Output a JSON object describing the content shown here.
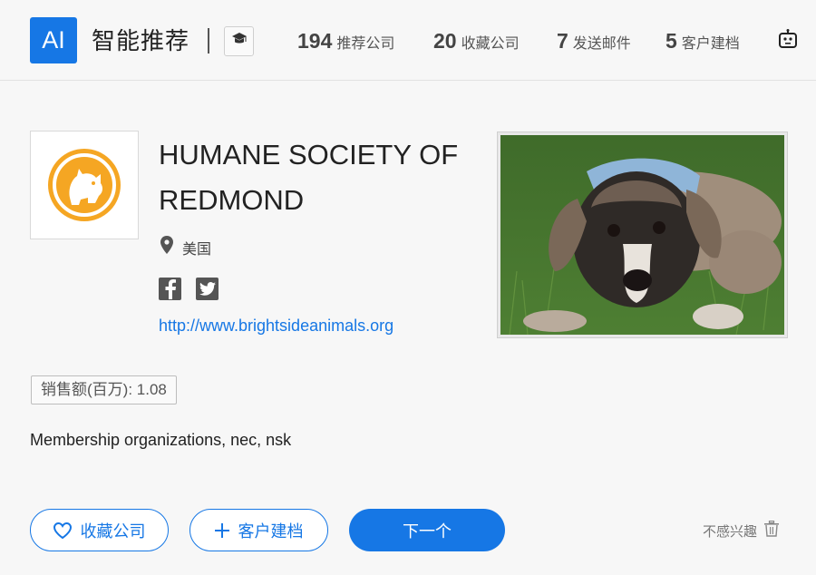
{
  "header": {
    "logo_text": "AI",
    "title": "智能推荐",
    "stats": [
      {
        "num": "194",
        "label": "推荐公司"
      },
      {
        "num": "20",
        "label": "收藏公司"
      },
      {
        "num": "7",
        "label": "发送邮件"
      },
      {
        "num": "5",
        "label": "客户建档"
      }
    ]
  },
  "company": {
    "name": "HUMANE SOCIETY OF REDMOND",
    "location": "美国",
    "website": "http://www.brightsideanimals.org",
    "sales": "销售额(百万): 1.08",
    "industry": "Membership organizations, nec, nsk"
  },
  "actions": {
    "favorite": "收藏公司",
    "add_customer": "客户建档",
    "next": "下一个",
    "not_interested": "不感兴趣"
  },
  "colors": {
    "accent": "#1677e5",
    "logo_orange": "#f5a623"
  },
  "icons": [
    "graduation-cap-icon",
    "robot-icon",
    "location-pin-icon",
    "facebook-icon",
    "twitter-icon",
    "heart-icon",
    "plus-icon",
    "trash-icon"
  ]
}
